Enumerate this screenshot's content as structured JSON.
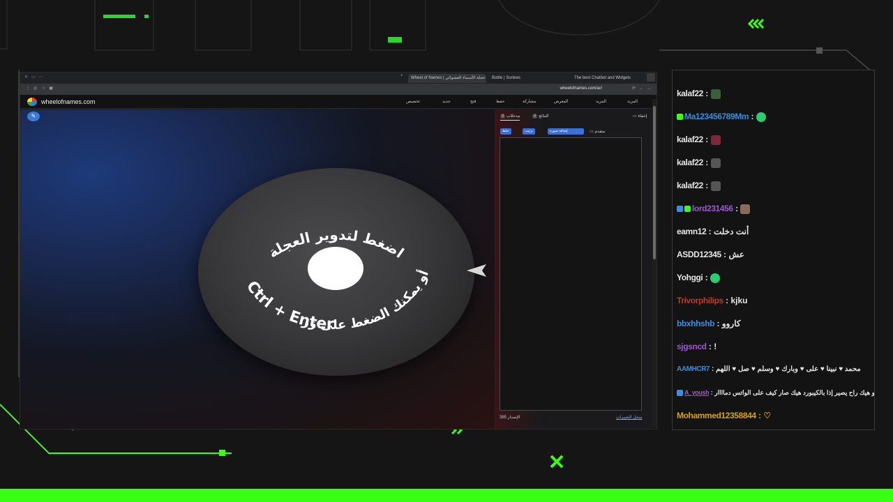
{
  "browser": {
    "tabs": [
      "Wheel of Names | عجلة الأسماء العشوائي",
      "Bottle | Sortees",
      "The best Chatbot and Widgets"
    ],
    "url": "wheelofnames.com/ar/"
  },
  "site": {
    "logo": "wheelofnames.com",
    "nav": [
      "المزيد",
      "المزيد",
      "المعرض",
      "مشاركة",
      "حفظ",
      "فتح",
      "جديد",
      "تخصيص"
    ]
  },
  "wheel": {
    "top_text": "اضغط لتدوير العجلة",
    "bottom_text": "أو يمكنك الضغط على زر",
    "shortcut": "Ctrl + Enter"
  },
  "panel": {
    "tab_entries": "مدخلات",
    "tab_entries_count": "0",
    "tab_results": "النتائج",
    "tab_results_count": "0",
    "hide_label": "إخفاء",
    "advanced_label": "متقدم",
    "chips": [
      "خلط",
      "ترتيب",
      "إضافة صورة"
    ],
    "version": "الإصدار 385",
    "changelog": "سجل التغييرات"
  },
  "chat": {
    "lines": [
      {
        "user": "kalaf22",
        "msg": ":",
        "color": "#e6e6e6"
      },
      {
        "user": "Ma123456789Mm",
        "msg": ":",
        "color": "#3a8de0"
      },
      {
        "user": "kalaf22",
        "msg": ":",
        "color": "#e6e6e6"
      },
      {
        "user": "kalaf22",
        "msg": ":",
        "color": "#e6e6e6"
      },
      {
        "user": "kalaf22",
        "msg": ":",
        "color": "#e6e6e6"
      },
      {
        "user": "lord231456",
        "msg": ":",
        "color": "#9b59d0"
      },
      {
        "user": "eamn12",
        "msg": ": أنت دخلت",
        "color": "#e6e6e6"
      },
      {
        "user": "ASDD12345",
        "msg": ": عش",
        "color": "#e6e6e6"
      },
      {
        "user": "Yohggi",
        "msg": ":",
        "color": "#e6e6e6"
      },
      {
        "user": "Trivorphilips",
        "msg": ": kjku",
        "color": "#c0392b"
      },
      {
        "user": "bbxhhshb",
        "msg": ": كاروو",
        "color": "#3a8de0"
      },
      {
        "user": "sjgsncd",
        "msg": ": !",
        "color": "#9b59d0"
      },
      {
        "user": "AAMHCR7",
        "msg": ": محمد ♥ نبينا ♥ على ♥ وبارك ♥ وسلم ♥ صل ♥ اللهم",
        "color": "#3a8de0"
      },
      {
        "user": "A_yoush",
        "msg": ": ابوة هو هيك راح يصير إذا بالكيبورد هيك صار كيف على الواتس دماااار",
        "color": "#9b59d0"
      },
      {
        "user": "Mohammed12358844",
        "msg": ": ♡",
        "color": "#d4a017"
      }
    ]
  },
  "colors": {
    "accent": "#39ff14",
    "wheel_blue": "#3e6fd8"
  }
}
